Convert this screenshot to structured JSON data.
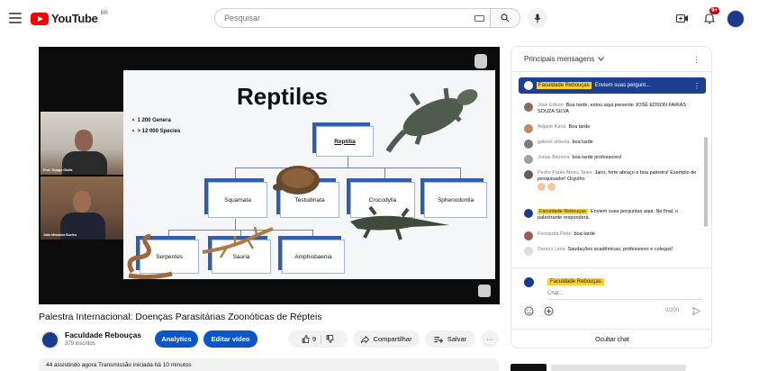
{
  "header": {
    "logo_text": "YouTube",
    "country_code": "BR",
    "search_placeholder": "Pesquisar",
    "notification_count": "9+",
    "brand_color": "#ff0000"
  },
  "video": {
    "title": "Palestra Internacional: Doenças Parasitárias Zoonóticas de Répteis",
    "slide": {
      "title": "Reptiles",
      "bullets": [
        "1 200 Genera",
        "> 12 000 Species"
      ],
      "root": "Reptilia",
      "level1": [
        "Squamata",
        "Testudinata",
        "Crocodylia",
        "Sphenodontia"
      ],
      "level2": [
        "Serpentes",
        "Sauria",
        "Amphisbaenia"
      ]
    },
    "cams": [
      {
        "name": "Prof. Thyago Gioifa"
      },
      {
        "name": "João Menaboa Bueleo"
      }
    ],
    "stats": "44 assistindo agora  Transmissão iniciada há 10 minutos"
  },
  "channel": {
    "name": "Faculdade Rebouças",
    "subs": "379 inscritos",
    "analytics_label": "Analytics",
    "edit_label": "Editar vídeo",
    "likes": "9",
    "share_label": "Compartilhar",
    "save_label": "Salvar",
    "more_label": "···"
  },
  "chat": {
    "header": "Principais mensagens",
    "pinned_author": "Faculdade Rebouças",
    "pinned_text": "Enviem suas pergunt...",
    "messages": [
      {
        "author": "José Edson",
        "text": "Boa tarde, estou aqui presente JOSÉ EDSON FARIAS SOUZA SILVA"
      },
      {
        "author": "Adjane Kariá",
        "text": "Boa tarde"
      },
      {
        "author": "gabriel oliveira",
        "text": "boa tarde"
      },
      {
        "author": "Jonas Bezerra",
        "text": "boa tarde professores!"
      },
      {
        "author": "Pedro Paulo Abreu Teles",
        "text": "Jairo, forte abraço e boa palestra! Exemplo de pesquisador! Orgulho"
      },
      {
        "author": "Faculdade Rebouças",
        "text": "Enviem suas perguntas aqui. No final, o palestrante responderá."
      },
      {
        "author": "Fernanda Pinto",
        "text": "boa tarde"
      },
      {
        "author": "Dennis Lima",
        "text": "Saudações acadêmicas, professores e colegas!"
      }
    ],
    "input_author": "Faculdade Rebouças",
    "input_placeholder": "Chat...",
    "counter": "0/200",
    "hide_label": "Ocultar chat"
  }
}
